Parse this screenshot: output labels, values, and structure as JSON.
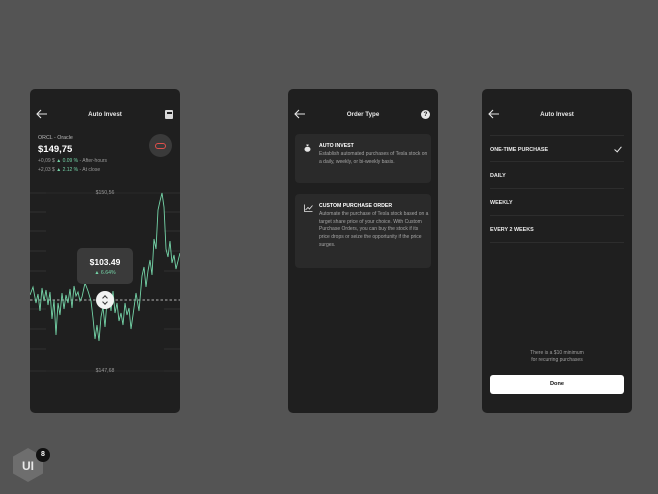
{
  "screen1": {
    "title": "Auto Invest",
    "symbol": "ORCL - Oracle",
    "price": "$149,75",
    "change_after_hours": {
      "prefix": "+0,09 $",
      "pct": "0.09 %",
      "suffix": "- After-hours"
    },
    "change_close": {
      "prefix": "+2,03 $",
      "pct": "2.12 %",
      "suffix": "- At close"
    },
    "high_label": "$150,56",
    "low_label": "$147,68",
    "tooltip_value": "$103.49",
    "tooltip_pct": "6.64%",
    "accent_color": "#74d3a7",
    "icons": {
      "back": "arrow-left-icon",
      "calculator": "calculator-icon",
      "logo": "oracle-logo-icon"
    }
  },
  "screen2": {
    "title": "Order Type",
    "cards": [
      {
        "title": "AUTO INVEST",
        "description": "Establish automated purchases of Tesla stock on a daily, weekly, or bi-weekly basis.",
        "icon": "money-bag-icon"
      },
      {
        "title": "CUSTOM PURCHASE ORDER",
        "description": "Automate the purchase of Tesla stock based on a target share price of your choice. With Custom Purchase Orders, you can buy the stock if its price drops or seize the opportunity if the price surges.",
        "icon": "trend-line-icon"
      }
    ]
  },
  "screen3": {
    "title": "Auto Invest",
    "options": [
      {
        "label": "ONE-TIME PURCHASE",
        "selected": true
      },
      {
        "label": "DAILY",
        "selected": false
      },
      {
        "label": "WEEKLY",
        "selected": false
      },
      {
        "label": "EVERY 2 WEEKS",
        "selected": false
      }
    ],
    "note_line1": "There is a $10 minimum",
    "note_line2": "for recurring purchases",
    "done_label": "Done"
  },
  "brand": {
    "logo_text": "UI",
    "badge": "8"
  }
}
